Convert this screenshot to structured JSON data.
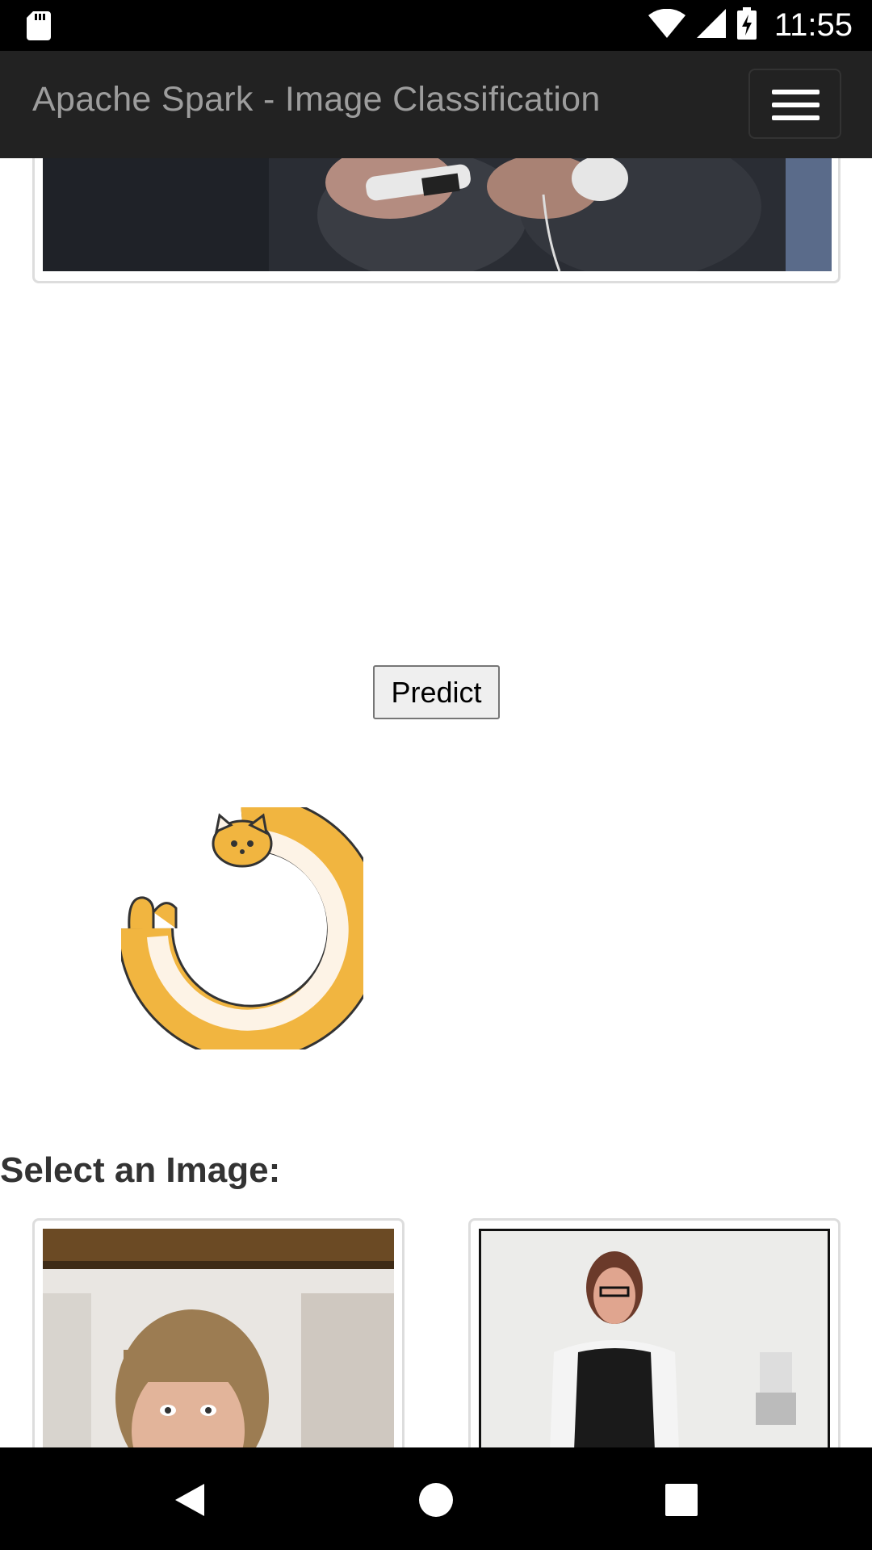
{
  "status_bar": {
    "time": "11:55",
    "icons": [
      "sd-card-icon",
      "wifi-icon",
      "signal-icon",
      "battery-charging-icon"
    ]
  },
  "navbar": {
    "brand": "Apache Spark - Image Classification",
    "toggle_icon": "hamburger-menu-icon"
  },
  "main": {
    "predict_label": "Predict",
    "select_heading": "Select an Image:"
  },
  "nav_bar": {
    "icons": [
      "back-icon",
      "home-icon",
      "recents-icon"
    ]
  }
}
